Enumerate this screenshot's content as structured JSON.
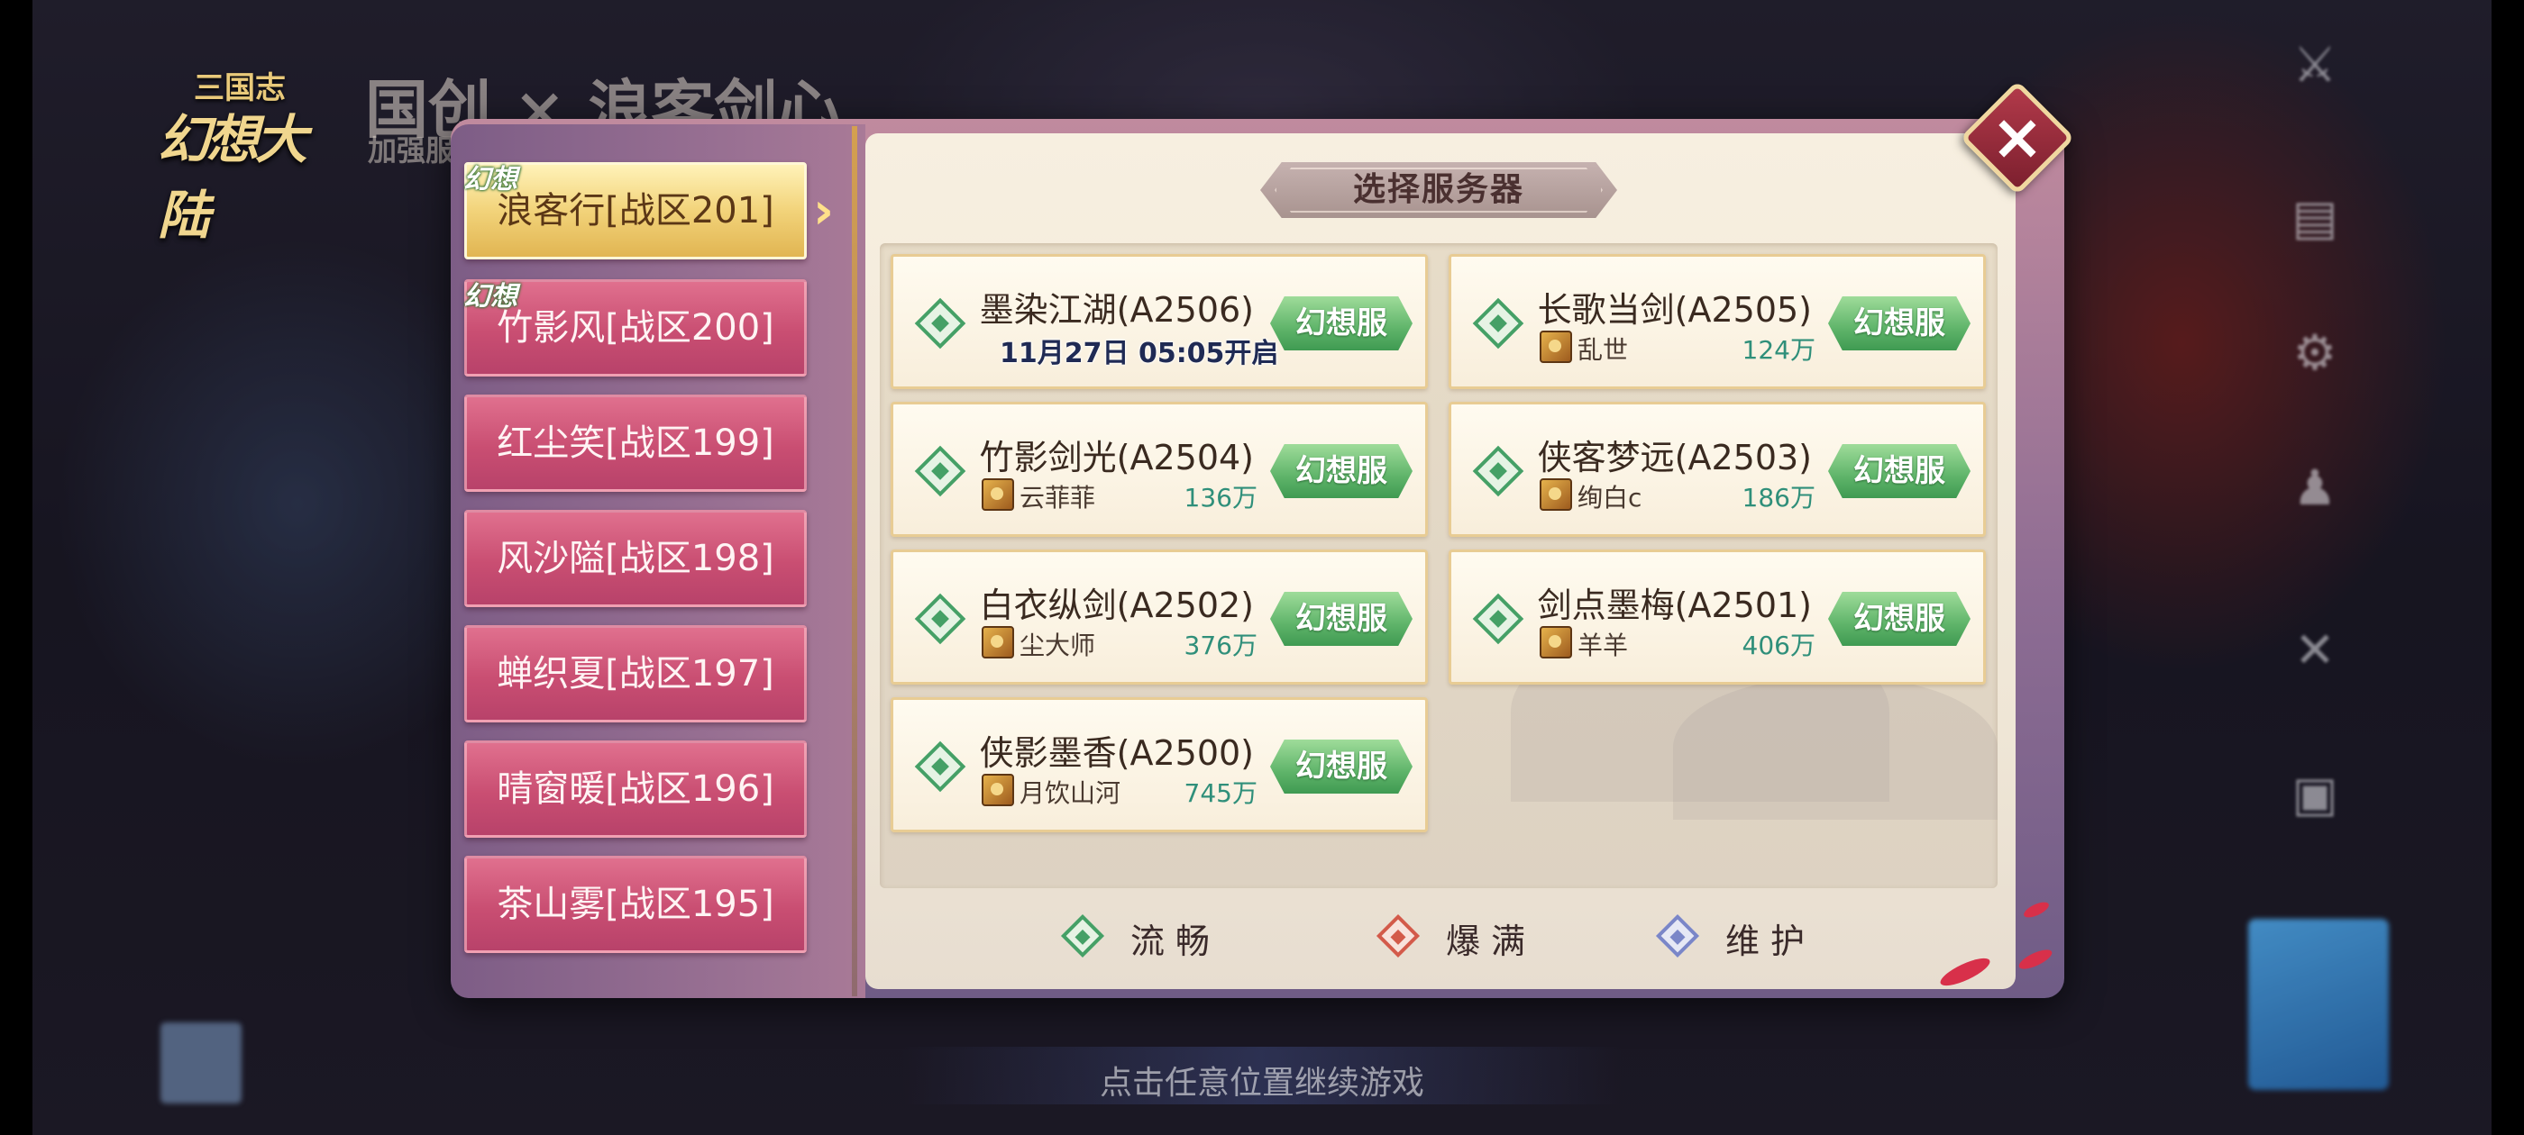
{
  "background": {
    "top_notice": "",
    "logo_top": "三国志",
    "logo_main": "幻想大陆",
    "collab_title": "国创 × 浪客剑心",
    "collab_sub": "加强服",
    "continue_hint": "点击任意位置继续游戏"
  },
  "dialog": {
    "title": "选择服务器",
    "close_icon": "close-x-icon"
  },
  "zone_tabs": [
    {
      "label": "浪客行[战区201]",
      "tag": "幻想",
      "active": true
    },
    {
      "label": "竹影风[战区200]",
      "tag": "幻想",
      "active": false
    },
    {
      "label": "红尘笑[战区199]",
      "tag": "",
      "active": false
    },
    {
      "label": "风沙隘[战区198]",
      "tag": "",
      "active": false
    },
    {
      "label": "蝉织夏[战区197]",
      "tag": "",
      "active": false
    },
    {
      "label": "晴窗暖[战区196]",
      "tag": "",
      "active": false
    },
    {
      "label": "茶山雾[战区195]",
      "tag": "",
      "active": false
    }
  ],
  "servers": [
    {
      "name": "墨染江湖(A2506)",
      "open_time": "11月27日 05:05开启",
      "player": "",
      "power": "",
      "badge": "幻想服",
      "status": "流畅"
    },
    {
      "name": "长歌当剑(A2505)",
      "open_time": "",
      "player": "乱世",
      "power": "124万",
      "badge": "幻想服",
      "status": "流畅"
    },
    {
      "name": "竹影剑光(A2504)",
      "open_time": "",
      "player": "云菲菲",
      "power": "136万",
      "badge": "幻想服",
      "status": "流畅"
    },
    {
      "name": "侠客梦远(A2503)",
      "open_time": "",
      "player": "绚白c",
      "power": "186万",
      "badge": "幻想服",
      "status": "流畅"
    },
    {
      "name": "白衣纵剑(A2502)",
      "open_time": "",
      "player": "尘大师",
      "power": "376万",
      "badge": "幻想服",
      "status": "流畅"
    },
    {
      "name": "剑点墨梅(A2501)",
      "open_time": "",
      "player": "羊羊",
      "power": "406万",
      "badge": "幻想服",
      "status": "流畅"
    },
    {
      "name": "侠影墨香(A2500)",
      "open_time": "",
      "player": "月饮山河",
      "power": "745万",
      "badge": "幻想服",
      "status": "流畅"
    }
  ],
  "legend": [
    {
      "label": "流畅",
      "color": "#45a066"
    },
    {
      "label": "爆满",
      "color": "#d35a4a"
    },
    {
      "label": "维护",
      "color": "#7a86c8"
    }
  ],
  "colors": {
    "tab_active": "#f2d37a",
    "tab_inactive": "#c94e72",
    "badge_green": "#5fb46a",
    "power_text": "#2f8f7a"
  }
}
